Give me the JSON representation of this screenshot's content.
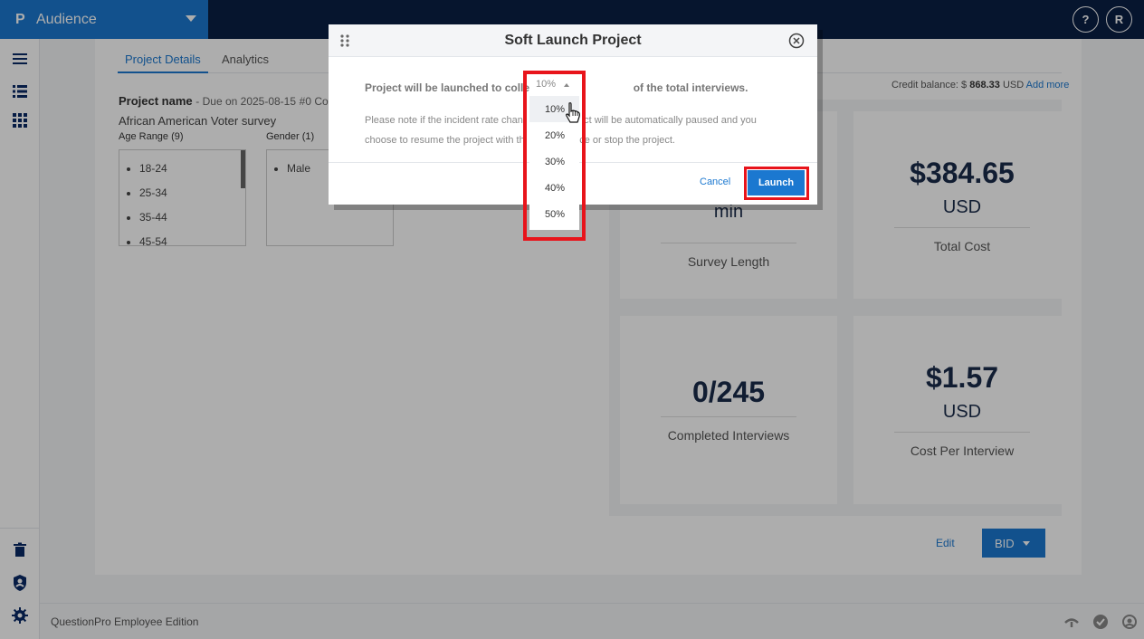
{
  "app": {
    "brand_logo": "P",
    "brand_name": "Audience",
    "help_label": "?",
    "user_initial": "R"
  },
  "tabs": [
    {
      "label": "Project Details",
      "active": true
    },
    {
      "label": "Analytics",
      "active": false
    }
  ],
  "project": {
    "name_label": "Project name",
    "due_text": "- Due on 2025-08-15",
    "complete_text": "#0 Com",
    "survey_name": "African American Voter survey"
  },
  "filters": {
    "age": {
      "title": "Age Range (9)",
      "items": [
        "18-24",
        "25-34",
        "35-44",
        "45-54"
      ]
    },
    "gender": {
      "title": "Gender (1)",
      "items": [
        "Male"
      ]
    }
  },
  "credit": {
    "label": "Credit balance: $",
    "amount": "868.33",
    "currency": "USD",
    "add_more": "Add more"
  },
  "stats": {
    "survey_length": {
      "unit": "min",
      "label": "Survey Length"
    },
    "total_cost": {
      "value": "$384.65",
      "unit": "USD",
      "label": "Total Cost"
    },
    "completed": {
      "value": "0/245",
      "label": "Completed Interviews"
    },
    "cost_per_interview": {
      "value": "$1.57",
      "unit": "USD",
      "label": "Cost Per Interview"
    }
  },
  "actions": {
    "edit": "Edit",
    "bid": "BID"
  },
  "footer": {
    "text": "QuestionPro Employee Edition"
  },
  "modal": {
    "title": "Soft Launch Project",
    "line1_start": "Project will be launched to collec",
    "line1_end": "of the total interviews.",
    "note_line1": "Please note if the incident rate chan                      ct will be automatically paused and you",
    "note_line2": "choose to resume the project with th                   ice or stop the project.",
    "cancel": "Cancel",
    "launch": "Launch"
  },
  "dropdown": {
    "selected": "10%",
    "options": [
      "10%",
      "20%",
      "30%",
      "40%",
      "50%"
    ],
    "hovered_index": 0
  },
  "colors": {
    "primary": "#1b78d0",
    "navy": "#0a1f44",
    "highlight": "#e8141b"
  }
}
